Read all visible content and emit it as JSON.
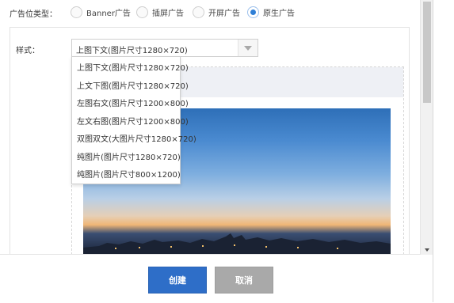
{
  "ad_type": {
    "label": "广告位类型：",
    "options": [
      {
        "label": "Banner广告",
        "checked": false
      },
      {
        "label": "插屏广告",
        "checked": false
      },
      {
        "label": "开屏广告",
        "checked": false
      },
      {
        "label": "原生广告",
        "checked": true
      }
    ]
  },
  "style": {
    "label": "样式：",
    "selected": "上图下文(图片尺寸1280×720)",
    "options": [
      "上图下文(图片尺寸1280×720)",
      "上文下图(图片尺寸1280×720)",
      "左图右文(图片尺寸1200×800)",
      "左文右图(图片尺寸1200×800)",
      "双图双文(大图片尺寸1280×720)",
      "纯图片(图片尺寸1280×720)",
      "纯图片(图片尺寸800×1200)"
    ]
  },
  "preview": {
    "image": "city-skyline-photo"
  },
  "footer": {
    "create_label": "创建",
    "cancel_label": "取消"
  },
  "colors": {
    "primary": "#2e6ec8",
    "disabled": "#a9a9a9",
    "radio_checked": "#2f7fd6"
  }
}
